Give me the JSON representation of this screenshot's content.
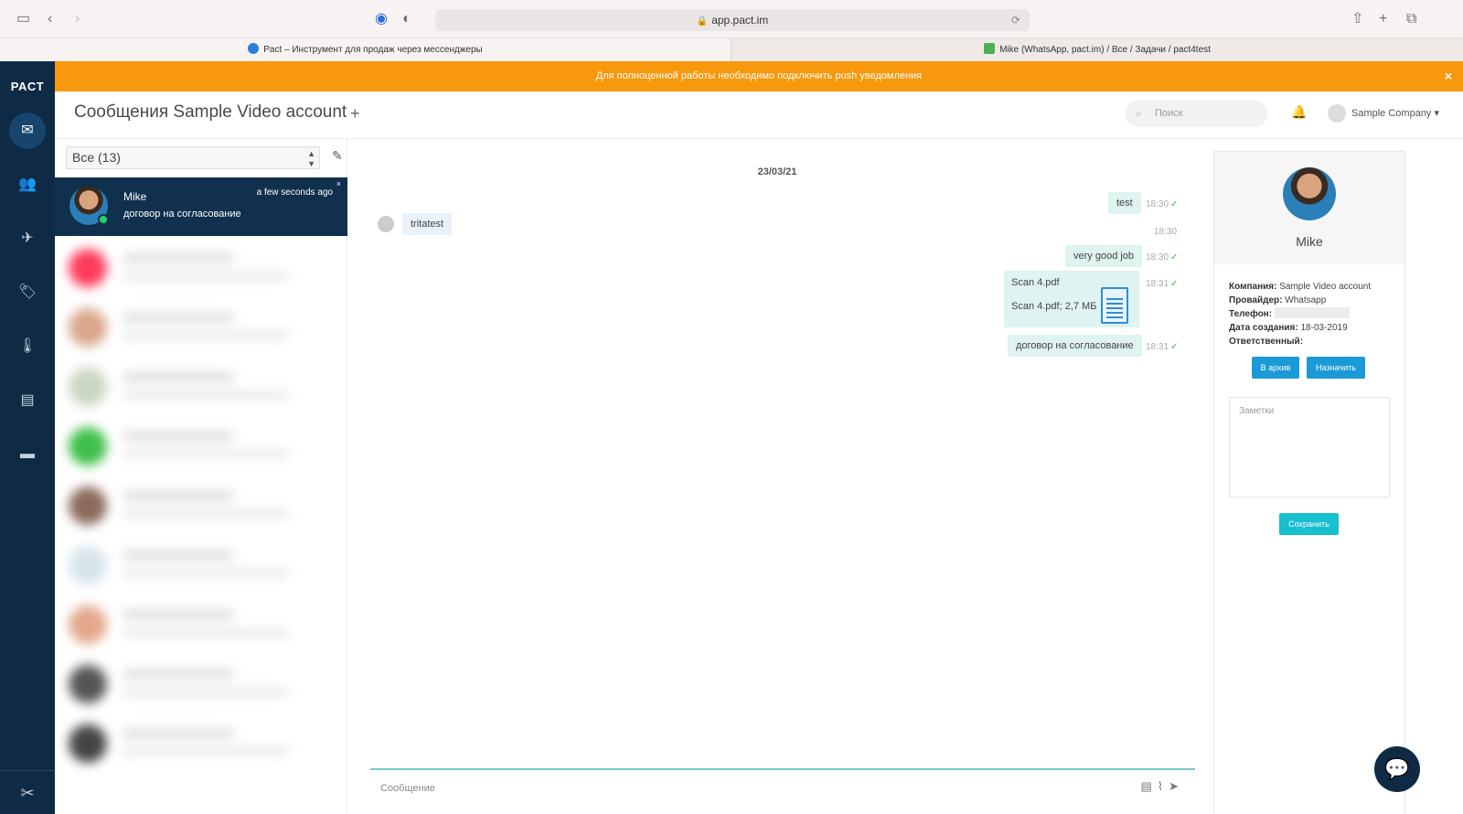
{
  "browser": {
    "url": "app.pact.im",
    "tabs": [
      {
        "title": "Pact – Инструмент для продаж через мессенджеры"
      },
      {
        "title": "Mike (WhatsApp, pact.im) / Все / Задачи / pact4test"
      }
    ]
  },
  "nav": {
    "logo": "PACT",
    "items": [
      "messages-icon",
      "contacts-icon",
      "broadcast-icon",
      "tags-icon",
      "thermometer-icon",
      "document-icon",
      "billing-icon"
    ],
    "bottom": "tools-icon"
  },
  "banner": {
    "text": "Для полноценной работы необходимо подключить push уведомления",
    "close": "×"
  },
  "header": {
    "title": "Сообщения Sample Video account",
    "add": "+",
    "search_placeholder": "Поиск",
    "company": "Sample Company ▾"
  },
  "conversations": {
    "filter": "Все (13)",
    "active": {
      "name": "Mike",
      "time": "a few seconds ago",
      "preview": "договор на согласование",
      "close": "×"
    },
    "blurred_colors": [
      "#ff3b5c",
      "#d9a78a",
      "#c9d6c0",
      "#3fbf4b",
      "#8b6a5a",
      "#d7e4ec",
      "#e3a88c",
      "#555555",
      "#444444"
    ]
  },
  "chat": {
    "date": "23/03/21",
    "messages": [
      {
        "dir": "out",
        "text": "test",
        "time": "18:30",
        "check": "✓"
      },
      {
        "dir": "in",
        "text": "tritatest",
        "time": "18:30"
      },
      {
        "dir": "out",
        "text": "very good job",
        "time": "18:30",
        "check": "✓"
      },
      {
        "dir": "out",
        "text": "Scan 4.pdf",
        "file": "Scan 4.pdf; 2,7 МБ",
        "time": "18:31",
        "check": "✓"
      },
      {
        "dir": "out",
        "text": "договор на согласование",
        "time": "18:31",
        "check": "✓"
      }
    ],
    "composer_placeholder": "Сообщение"
  },
  "contact": {
    "name": "Mike",
    "company_label": "Компания:",
    "company": "Sample Video account",
    "provider_label": "Провайдер:",
    "provider": "Whatsapp",
    "phone_label": "Телефон:",
    "created_label": "Дата создания:",
    "created": "18-03-2019",
    "responsible_label": "Ответственный:",
    "archive_button": "В архив",
    "assign_button": "Назначить",
    "notes_placeholder": "Заметки",
    "save_button": "Сохранить"
  }
}
